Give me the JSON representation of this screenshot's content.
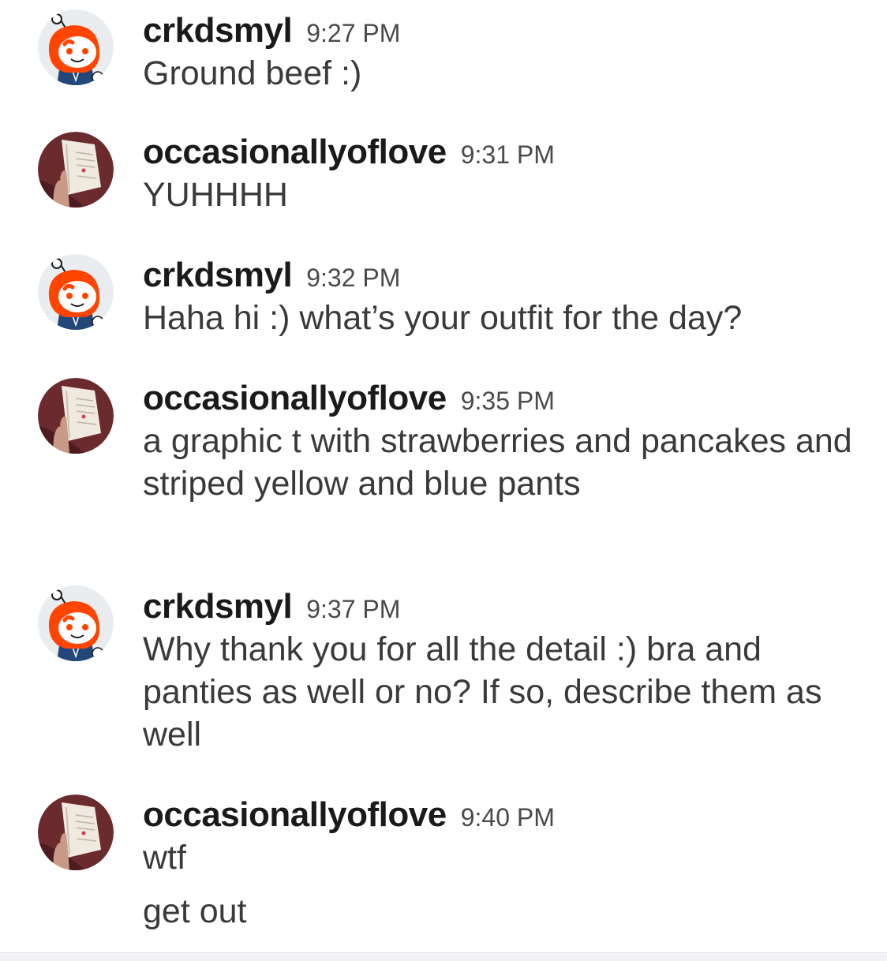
{
  "messages": [
    {
      "user": "crkdsmyl",
      "time": "9:27 PM",
      "avatar_icon": "snoo-avatar-icon",
      "lines": [
        "Ground beef :)"
      ]
    },
    {
      "user": "occasionallyoflove",
      "time": "9:31 PM",
      "avatar_icon": "photo-avatar-icon",
      "lines": [
        "YUHHHH"
      ]
    },
    {
      "user": "crkdsmyl",
      "time": "9:32 PM",
      "avatar_icon": "snoo-avatar-icon",
      "lines": [
        "Haha hi :) what’s your outfit for the day?"
      ]
    },
    {
      "user": "occasionallyoflove",
      "time": "9:35 PM",
      "avatar_icon": "photo-avatar-icon",
      "lines": [
        "a graphic t with strawberries and pancakes and striped yellow and blue pants"
      ]
    },
    {
      "user": "crkdsmyl",
      "time": "9:37 PM",
      "avatar_icon": "snoo-avatar-icon",
      "lines": [
        "Why thank you for all the detail :) bra and panties as well or no? If so, describe them as well"
      ]
    },
    {
      "user": "occasionallyoflove",
      "time": "9:40 PM",
      "avatar_icon": "photo-avatar-icon",
      "lines": [
        "wtf",
        "get out"
      ]
    }
  ],
  "colors": {
    "username": "#1a1a1b",
    "timestamp": "#4a4a4c",
    "message_text": "#3a3a3c",
    "snoo_orange": "#ff4500",
    "snoo_hoodie": "#24477a"
  }
}
